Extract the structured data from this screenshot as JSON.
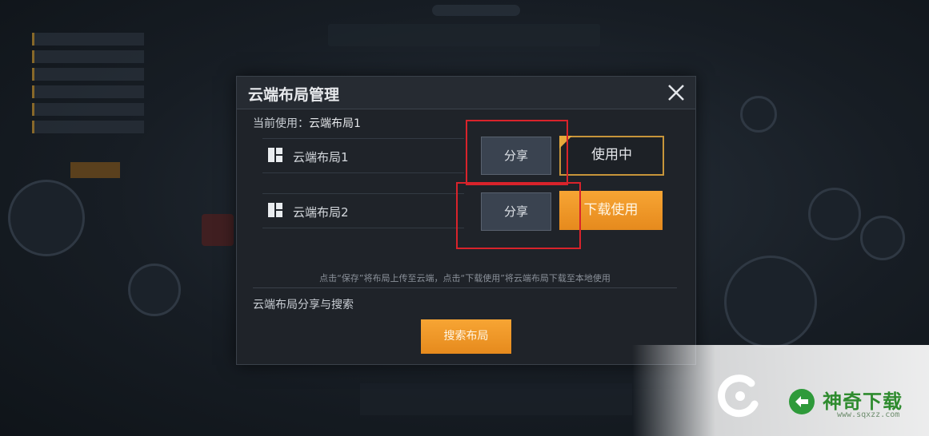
{
  "dialog": {
    "title": "云端布局管理",
    "current_label": "当前使用：",
    "current_value": "云端布局1",
    "layouts": [
      {
        "name": "云端布局1",
        "share_label": "分享",
        "action_label": "使用中",
        "status": "in-use"
      },
      {
        "name": "云端布局2",
        "share_label": "分享",
        "action_label": "下载使用",
        "status": "download"
      }
    ],
    "hint": "点击“保存”将布局上传至云端，点击“下载使用”将云端布局下载至本地使用",
    "section_title": "云端布局分享与搜索",
    "search_button": "搜索布局"
  },
  "watermark": {
    "name": "神奇下载",
    "url": "www.sqxzz.com"
  },
  "colors": {
    "accent_orange": "#f29a2a",
    "highlight_red": "#d9232b",
    "dialog_bg": "#1f2329"
  },
  "icons": [
    "close-icon",
    "layout-grid-icon",
    "in-use-flag-icon"
  ]
}
